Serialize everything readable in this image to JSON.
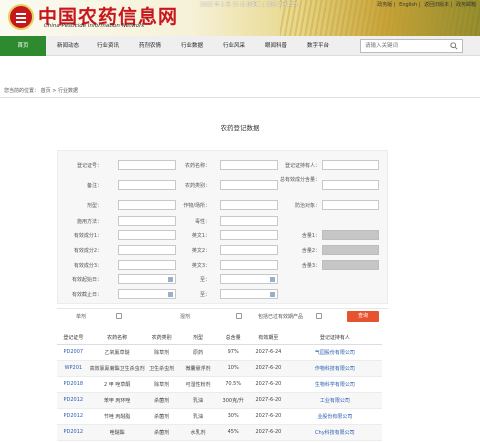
{
  "header": {
    "logo_title": "中国农药信息网",
    "logo_subtitle": "China Pesticide Information Network",
    "date_line": "2022 年 3 月 15 日 星期二 | 农历 2月13日",
    "top_links": [
      "政务版",
      "English",
      "返回旧版本",
      "政务邮箱"
    ]
  },
  "nav": {
    "items": [
      "首页",
      "新闻动态",
      "行业资讯",
      "药剂农情",
      "行业数据",
      "行业风采",
      "眼闻科普",
      "数字平台"
    ],
    "search_placeholder": "请输入关键词"
  },
  "breadcrumb": [
    "您当前的位置：",
    "首页",
    ">",
    "行业数据"
  ],
  "page_title": "农药登记数据",
  "form": {
    "labels": {
      "reg_no": "登记证号：",
      "pesticide_name": "农药名称：",
      "holder": "登记证持有人：",
      "note": "备注：",
      "category": "农药类别：",
      "total_content": "总有效成分含量：",
      "formulation": "剂型：",
      "crop": "作物/场所：",
      "target": "防治对象：",
      "usage": "施用方法：",
      "toxicity": "毒性：",
      "ingredient1": "有效成分1：",
      "ingredient2": "有效成分2：",
      "ingredient3": "有效成分3：",
      "english1": "英文1：",
      "english2": "英文2：",
      "english3": "英文3：",
      "content1": "含量1：",
      "content2": "含量2：",
      "content3": "含量3：",
      "valid_from": "有效起始日：",
      "valid_to": "有效截止日：",
      "to1": "至：",
      "to2": "至："
    },
    "filters": [
      "单剂",
      "混剂",
      "包括已过有效期产品"
    ],
    "query_button": "查询"
  },
  "table": {
    "headers": [
      "登记证号",
      "农药名称",
      "农药类别",
      "剂型",
      "总含量",
      "有效期至",
      "登记证持有人"
    ],
    "rows": [
      [
        "PD2007",
        "乙氧氟草醚",
        "除草剂",
        "原药",
        "97%",
        "2027-6-24",
        "气园股份有限公司"
      ],
      [
        "WP201",
        "高效氯氰菊酯卫生杀虫剂",
        "卫生杀虫剂",
        "微囊悬浮剂",
        "10%",
        "2027-6-20",
        "作物科技有限公司"
      ],
      [
        "PD2018",
        "2 甲 唑草酮",
        "除草剂",
        "可湿性粉剂",
        "70.5%",
        "2027-6-20",
        "生物科学有限公司"
      ],
      [
        "PD2012",
        "苯甲 丙环唑",
        "杀菌剂",
        "乳油",
        "300克/升",
        "2027-6-20",
        "工业有限公司"
      ],
      [
        "PD2012",
        "节唑 丙醚脂",
        "杀菌剂",
        "乳油",
        "30%",
        "2027-6-20",
        "业股份有限公司"
      ],
      [
        "PD2012",
        "唑醚酯",
        "杀菌剂",
        "水乳剂",
        "45%",
        "2027-6-20",
        "Chy科技有限公司"
      ]
    ]
  },
  "colors": {
    "brand_red": "#c8161d",
    "nav_active": "#2e8a2e",
    "query_button": "#e8532f"
  }
}
